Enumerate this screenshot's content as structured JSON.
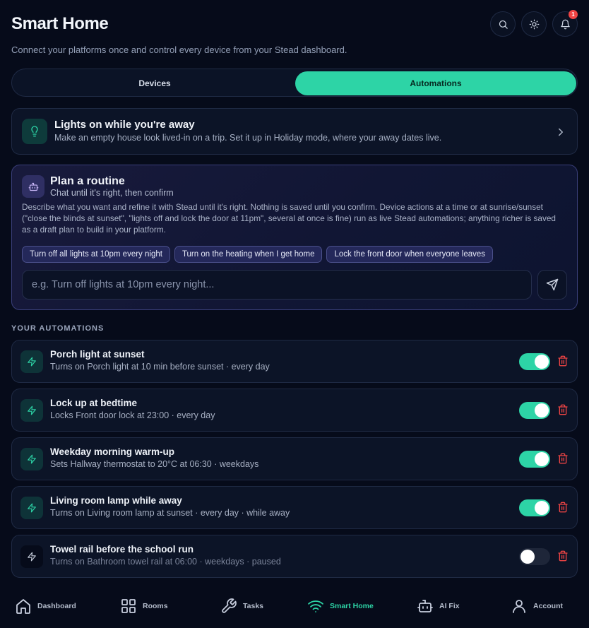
{
  "header": {
    "title": "Smart Home",
    "subtitle": "Connect your platforms once and control every device from your Stead dashboard.",
    "notification_count": "1"
  },
  "tabs": [
    {
      "label": "Devices",
      "active": false
    },
    {
      "label": "Automations",
      "active": true
    }
  ],
  "away_card": {
    "title": "Lights on while you're away",
    "description": "Make an empty house look lived-in on a trip. Set it up in Holiday mode, where your away dates live."
  },
  "routine": {
    "title": "Plan a routine",
    "subtitle": "Chat until it's right, then confirm",
    "description": "Describe what you want and refine it with Stead until it's right. Nothing is saved until you confirm. Device actions at a time or at sunrise/sunset (\"close the blinds at sunset\", \"lights off and lock the door at 11pm\", several at once is fine) run as live Stead automations; anything richer is saved as a draft plan to build in your platform.",
    "chips": [
      "Turn off all lights at 10pm every night",
      "Turn on the heating when I get home",
      "Lock the front door when everyone leaves"
    ],
    "input_placeholder": "e.g. Turn off lights at 10pm every night..."
  },
  "automations_section": {
    "title": "YOUR AUTOMATIONS",
    "items": [
      {
        "name": "Porch light at sunset",
        "summary": "Turns on Porch light at 10 min before sunset · every day",
        "enabled": true
      },
      {
        "name": "Lock up at bedtime",
        "summary": "Locks Front door lock at 23:00 · every day",
        "enabled": true
      },
      {
        "name": "Weekday morning warm-up",
        "summary": "Sets Hallway thermostat to 20°C at 06:30 · weekdays",
        "enabled": true
      },
      {
        "name": "Living room lamp while away",
        "summary": "Turns on Living room lamp at sunset · every day · while away",
        "enabled": true
      },
      {
        "name": "Towel rail before the school run",
        "summary": "Turns on Bathroom towel rail at 06:00 · weekdays · paused",
        "enabled": false
      }
    ]
  },
  "nav": {
    "items": [
      {
        "label": "Dashboard",
        "icon": "home-icon",
        "active": false
      },
      {
        "label": "Rooms",
        "icon": "grid-icon",
        "active": false
      },
      {
        "label": "Tasks",
        "icon": "wrench-icon",
        "active": false
      },
      {
        "label": "Smart Home",
        "icon": "wifi-icon",
        "active": true
      },
      {
        "label": "AI Fix",
        "icon": "robot-icon",
        "active": false
      },
      {
        "label": "Account",
        "icon": "user-icon",
        "active": false
      }
    ]
  },
  "colors": {
    "accent": "#2dd4a6",
    "background": "#060b1a",
    "danger": "#ef4444"
  }
}
